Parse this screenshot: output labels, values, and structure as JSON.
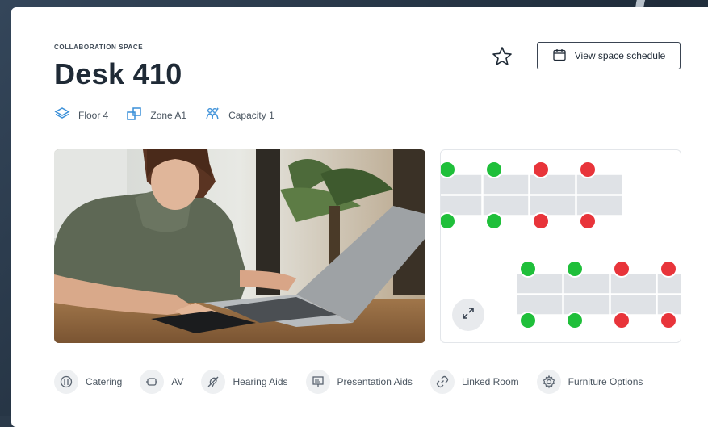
{
  "space": {
    "category": "COLLABORATION SPACE",
    "name": "Desk 410",
    "floor": "Floor 4",
    "zone": "Zone A1",
    "capacity": "Capacity 1"
  },
  "actions": {
    "schedule_label": "View space schedule"
  },
  "amenities": [
    {
      "label": "Catering",
      "icon": "catering-icon"
    },
    {
      "label": "AV",
      "icon": "av-icon"
    },
    {
      "label": "Hearing Aids",
      "icon": "hearing-aids-icon"
    },
    {
      "label": "Presentation Aids",
      "icon": "presentation-aids-icon"
    },
    {
      "label": "Linked Room",
      "icon": "link-icon"
    },
    {
      "label": "Furniture Options",
      "icon": "gear-icon"
    }
  ],
  "colors": {
    "available": "#1fbf3a",
    "occupied": "#e8343a",
    "accent": "#3a8fd8",
    "desk": "#dfe2e6"
  },
  "floor_map": {
    "desks": [
      {
        "status": "available"
      },
      {
        "status": "available"
      },
      {
        "status": "occupied"
      },
      {
        "status": "occupied"
      },
      {
        "status": "available"
      },
      {
        "status": "available"
      },
      {
        "status": "occupied"
      },
      {
        "status": "occupied"
      },
      {
        "status": "available"
      },
      {
        "status": "available"
      },
      {
        "status": "occupied"
      },
      {
        "status": "occupied"
      },
      {
        "status": "available"
      },
      {
        "status": "available"
      },
      {
        "status": "occupied"
      },
      {
        "status": "occupied"
      }
    ]
  }
}
